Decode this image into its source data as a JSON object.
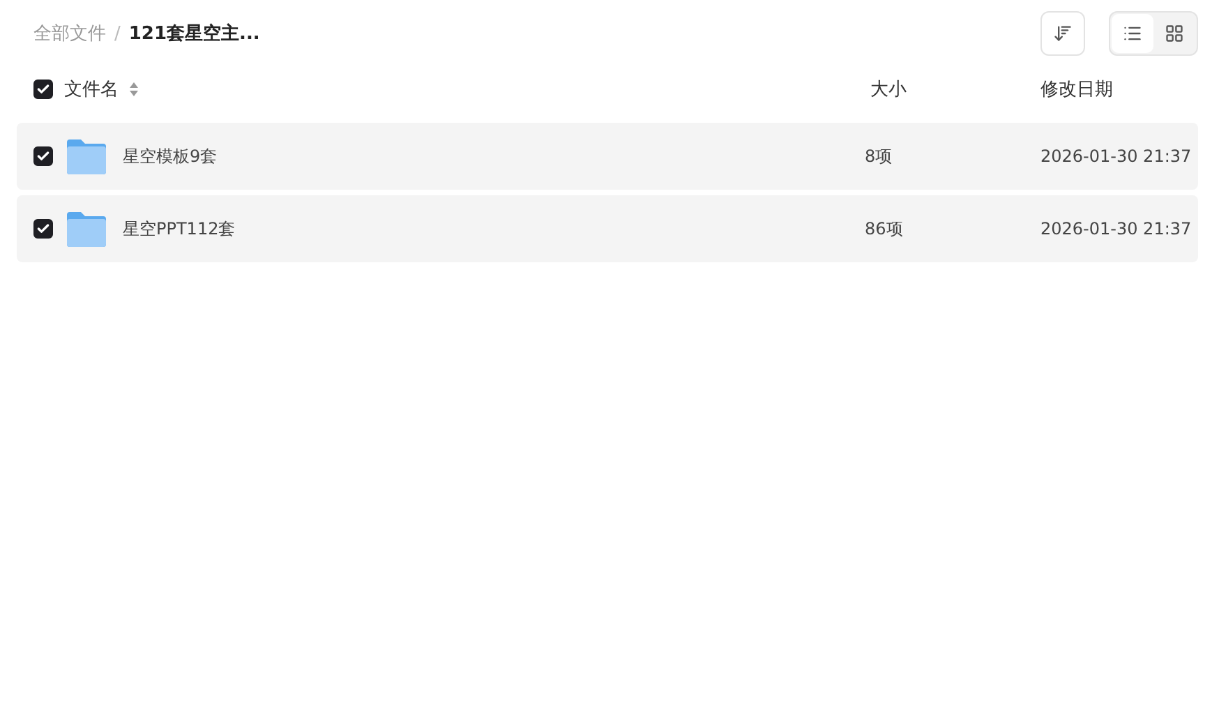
{
  "breadcrumb_separator": "/",
  "breadcrumb": [
    {
      "label": "全部文件",
      "current": false
    },
    {
      "label": "121套星空主...",
      "current": true
    }
  ],
  "view_toggle": [
    {
      "kind": "list",
      "selected": true
    },
    {
      "kind": "grid",
      "selected": false
    }
  ],
  "table": {
    "select_all_checked": true,
    "columns": [
      "文件名",
      "大小",
      "修改日期"
    ],
    "rows": [
      {
        "name": "星空模板9套",
        "size": "8项",
        "modified": "2026-01-30 21:37",
        "checked": true
      },
      {
        "name": "星空PPT112套",
        "size": "86项",
        "modified": "2026-01-30 21:37",
        "checked": true
      }
    ]
  }
}
